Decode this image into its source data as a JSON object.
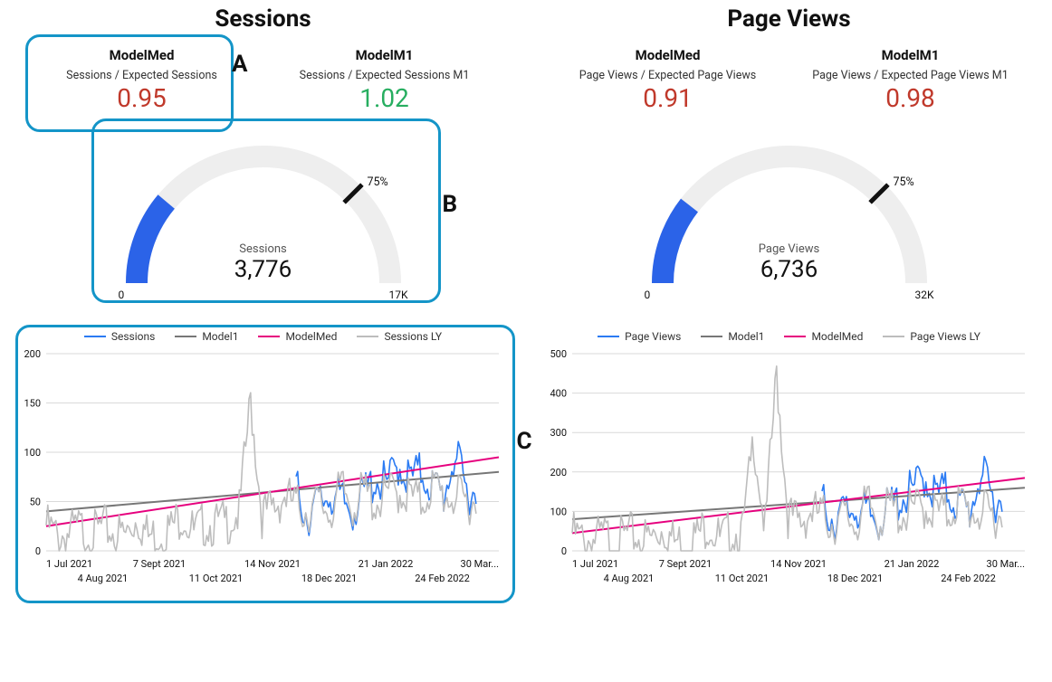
{
  "sessions": {
    "title": "Sessions",
    "kpis": [
      {
        "name": "ModelMed",
        "sub": "Sessions / Expected Sessions",
        "value": "0.95",
        "color": "red"
      },
      {
        "name": "ModelM1",
        "sub": "Sessions / Expected Sessions M1",
        "value": "1.02",
        "color": "green"
      }
    ],
    "gauge": {
      "label": "Sessions",
      "value": 3776,
      "valueText": "3,776",
      "min": 0,
      "minText": "0",
      "max": 17000,
      "maxText": "17K",
      "tickPct": 75,
      "tickLabel": "75%"
    },
    "timeseries": {
      "legend": [
        "Sessions",
        "Model1",
        "ModelMed",
        "Sessions LY"
      ],
      "ymax": 200,
      "yticks": [
        0,
        50,
        100,
        150,
        200
      ],
      "xlabels_top": [
        "1 Jul 2021",
        "7 Sept 2021",
        "14 Nov 2021",
        "21 Jan 2022",
        "30 Mar..."
      ],
      "xlabels_bottom": [
        "4 Aug 2021",
        "11 Oct 2021",
        "18 Dec 2021",
        "24 Feb 2022"
      ]
    }
  },
  "pageviews": {
    "title": "Page Views",
    "kpis": [
      {
        "name": "ModelMed",
        "sub": "Page Views / Expected Page Views",
        "value": "0.91",
        "color": "red"
      },
      {
        "name": "ModelM1",
        "sub": "Page Views / Expected Page Views M1",
        "value": "0.98",
        "color": "red"
      }
    ],
    "gauge": {
      "label": "Page Views",
      "value": 6736,
      "valueText": "6,736",
      "min": 0,
      "minText": "0",
      "max": 32000,
      "maxText": "32K",
      "tickPct": 75,
      "tickLabel": "75%"
    },
    "timeseries": {
      "legend": [
        "Page Views",
        "Model1",
        "ModelMed",
        "Page Views LY"
      ],
      "ymax": 500,
      "yticks": [
        0,
        100,
        200,
        300,
        400,
        500
      ],
      "xlabels_top": [
        "1 Jul 2021",
        "7 Sept 2021",
        "14 Nov 2021",
        "21 Jan 2022",
        "30 Mar..."
      ],
      "xlabels_bottom": [
        "4 Aug 2021",
        "11 Oct 2021",
        "18 Dec 2021",
        "24 Feb 2022"
      ]
    }
  },
  "annotations": {
    "A": "A",
    "B": "B",
    "C": "C"
  },
  "chart_data": [
    {
      "type": "line",
      "title": "Sessions",
      "xrange": [
        "2021-07-01",
        "2022-03-30"
      ],
      "ylim": [
        0,
        200
      ],
      "series": [
        {
          "name": "Sessions",
          "color": "#2b7bf3",
          "approx": true,
          "values_by_week": [
            null,
            null,
            null,
            null,
            null,
            null,
            null,
            null,
            null,
            null,
            null,
            null,
            null,
            null,
            null,
            null,
            null,
            null,
            null,
            null,
            null,
            null,
            75,
            48,
            60,
            70,
            62,
            54,
            70,
            85,
            78,
            100,
            84,
            92,
            78,
            68,
            110,
            72,
            null,
            null
          ]
        },
        {
          "name": "Model1",
          "color": "#777777",
          "type": "trend",
          "start_y": 40,
          "end_y": 80
        },
        {
          "name": "ModelMed",
          "color": "#e6007e",
          "type": "trend",
          "start_y": 25,
          "end_y": 95
        },
        {
          "name": "Sessions LY",
          "color": "#bdbdbd",
          "approx": true,
          "values_by_week": [
            38,
            26,
            30,
            35,
            28,
            36,
            30,
            28,
            46,
            26,
            30,
            35,
            50,
            30,
            40,
            38,
            42,
            50,
            165,
            48,
            55,
            68,
            58,
            52,
            60,
            52,
            75,
            58,
            72,
            60,
            70,
            72,
            68,
            60,
            78,
            68,
            66,
            62,
            null,
            null
          ]
        }
      ]
    },
    {
      "type": "line",
      "title": "Page Views",
      "xrange": [
        "2021-07-01",
        "2022-03-30"
      ],
      "ylim": [
        0,
        500
      ],
      "series": [
        {
          "name": "Page Views",
          "color": "#2b7bf3",
          "approx": true,
          "values_by_week": [
            null,
            null,
            null,
            null,
            null,
            null,
            null,
            null,
            null,
            null,
            null,
            null,
            null,
            null,
            null,
            null,
            null,
            null,
            null,
            null,
            null,
            null,
            150,
            110,
            125,
            140,
            120,
            110,
            140,
            165,
            180,
            220,
            170,
            180,
            150,
            130,
            230,
            160,
            null,
            null
          ]
        },
        {
          "name": "Model1",
          "color": "#777777",
          "type": "trend",
          "start_y": 80,
          "end_y": 160
        },
        {
          "name": "ModelMed",
          "color": "#e6007e",
          "type": "trend",
          "start_y": 45,
          "end_y": 185
        },
        {
          "name": "Page Views LY",
          "color": "#bdbdbd",
          "approx": true,
          "values_by_week": [
            75,
            55,
            60,
            68,
            55,
            72,
            60,
            62,
            90,
            52,
            58,
            68,
            100,
            58,
            78,
            74,
            315,
            84,
            480,
            120,
            100,
            130,
            120,
            100,
            115,
            100,
            150,
            110,
            140,
            120,
            135,
            140,
            130,
            120,
            155,
            130,
            125,
            120,
            null,
            null
          ]
        }
      ]
    },
    {
      "type": "gauge",
      "title": "Sessions",
      "value": 3776,
      "min": 0,
      "max": 17000,
      "marker_pct": 75
    },
    {
      "type": "gauge",
      "title": "Page Views",
      "value": 6736,
      "min": 0,
      "max": 32000,
      "marker_pct": 75
    }
  ]
}
